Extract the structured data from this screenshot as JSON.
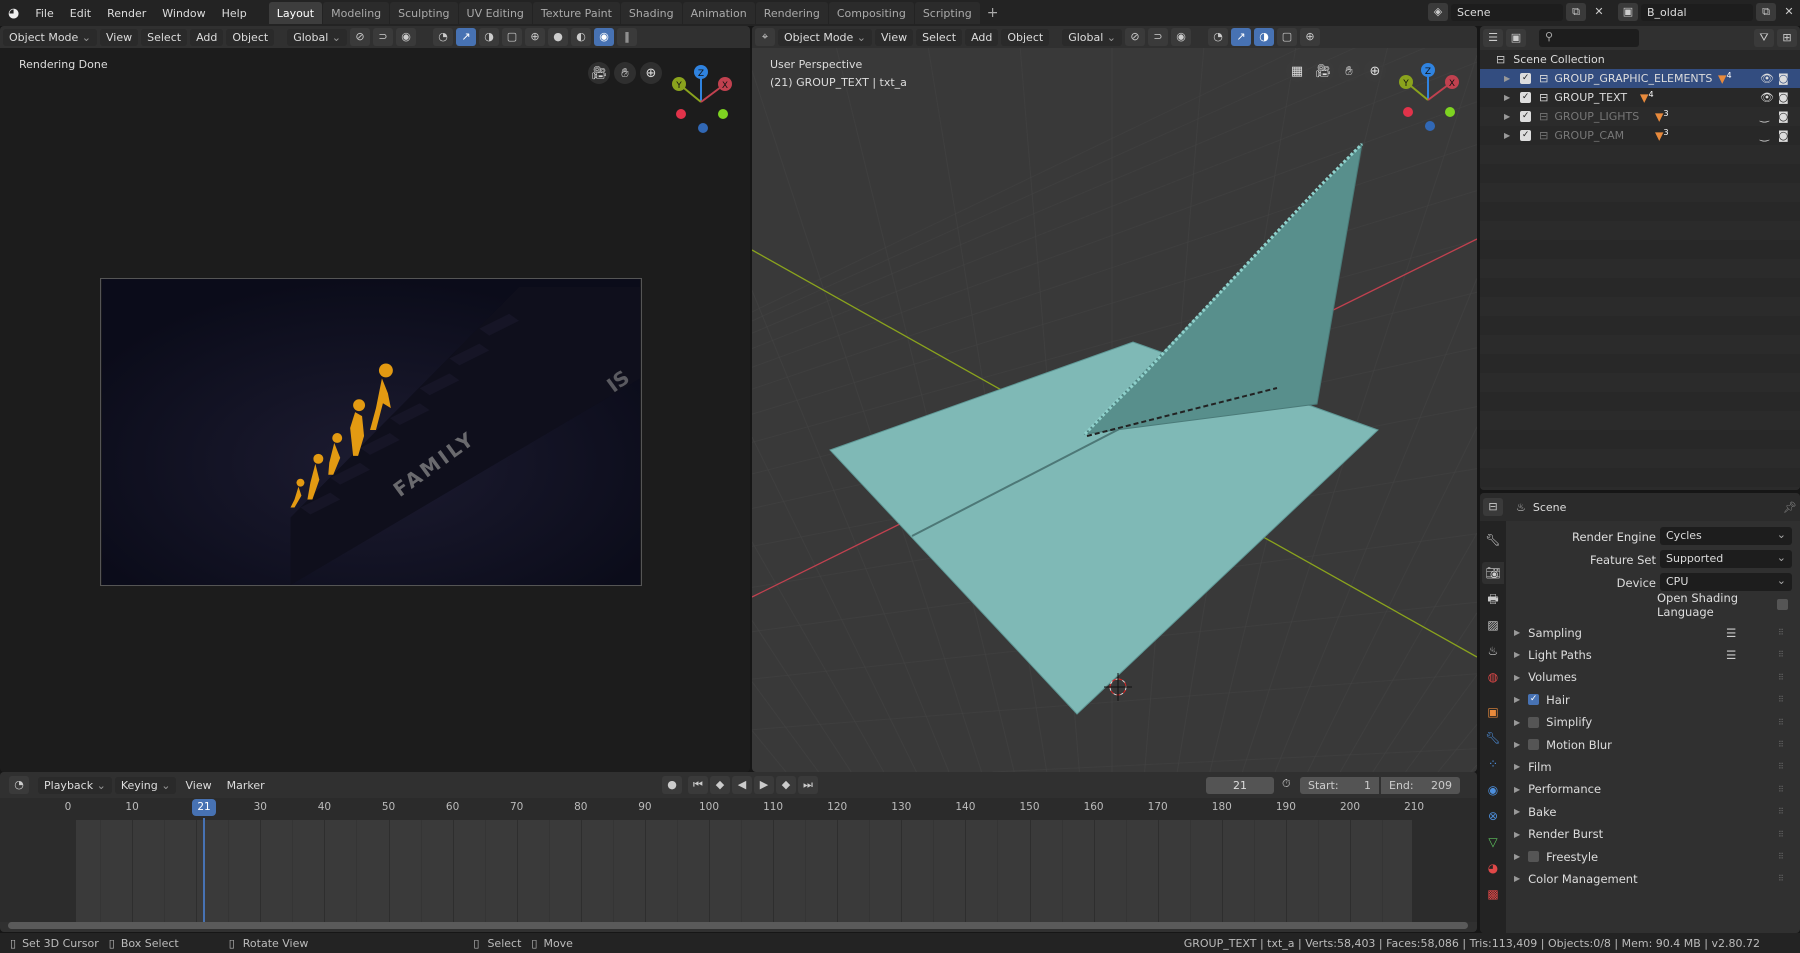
{
  "topbar": {
    "menus": [
      "File",
      "Edit",
      "Render",
      "Window",
      "Help"
    ],
    "tabs": [
      "Layout",
      "Modeling",
      "Sculpting",
      "UV Editing",
      "Texture Paint",
      "Shading",
      "Animation",
      "Rendering",
      "Compositing",
      "Scripting"
    ],
    "active_tab": "Layout",
    "scene": "Scene",
    "view_layer": "B_oldal"
  },
  "image_editor": {
    "mode": "Object Mode",
    "menus": [
      "View",
      "Select",
      "Add",
      "Object"
    ],
    "orientation": "Global",
    "status": "Rendering Done",
    "render_text": [
      "FAMILY",
      "IS"
    ]
  },
  "viewport": {
    "mode": "Object Mode",
    "menus": [
      "View",
      "Select",
      "Add",
      "Object"
    ],
    "orientation": "Global",
    "perspective": "User Perspective",
    "object_info": "(21) GROUP_TEXT | txt_a",
    "axes": {
      "x": "X",
      "y": "Y",
      "z": "Z"
    },
    "colors": {
      "plane": "#7fb9b6",
      "x_axis": "#c1414f",
      "y_axis": "#8aa31d"
    }
  },
  "outliner": {
    "root": "Scene Collection",
    "items": [
      {
        "name": "GROUP_GRAPHIC_ELEMENTS",
        "badge": "4",
        "selected": true,
        "visible": true
      },
      {
        "name": "GROUP_TEXT",
        "badge": "4",
        "selected": false,
        "visible": true
      },
      {
        "name": "GROUP_LIGHTS",
        "badge": "3",
        "selected": false,
        "visible": false
      },
      {
        "name": "GROUP_CAM",
        "badge": "3",
        "selected": false,
        "visible": false
      }
    ]
  },
  "properties": {
    "context": "Scene",
    "render_engine_label": "Render Engine",
    "render_engine": "Cycles",
    "feature_set_label": "Feature Set",
    "feature_set": "Supported",
    "device_label": "Device",
    "device": "CPU",
    "osl_label": "Open Shading Language",
    "osl": false,
    "panels": [
      {
        "label": "Sampling",
        "check": null
      },
      {
        "label": "Light Paths",
        "check": null
      },
      {
        "label": "Volumes",
        "check": null
      },
      {
        "label": "Hair",
        "check": true
      },
      {
        "label": "Simplify",
        "check": false
      },
      {
        "label": "Motion Blur",
        "check": false
      },
      {
        "label": "Film",
        "check": null
      },
      {
        "label": "Performance",
        "check": null
      },
      {
        "label": "Bake",
        "check": null
      },
      {
        "label": "Render Burst",
        "check": null
      },
      {
        "label": "Freestyle",
        "check": false
      },
      {
        "label": "Color Management",
        "check": null
      }
    ]
  },
  "timeline": {
    "menus": [
      "Playback",
      "Keying",
      "View",
      "Marker"
    ],
    "current_frame": "21",
    "start_label": "Start:",
    "start": "1",
    "end_label": "End:",
    "end": "209",
    "ticks": [
      "0",
      "10",
      "20",
      "30",
      "40",
      "50",
      "60",
      "70",
      "80",
      "90",
      "100",
      "110",
      "120",
      "130",
      "140",
      "150",
      "160",
      "170",
      "180",
      "190",
      "200",
      "210"
    ]
  },
  "statusbar": {
    "left": [
      "Set 3D Cursor",
      "Box Select",
      "Rotate View",
      "Select",
      "Move"
    ],
    "stats": "GROUP_TEXT | txt_a | Verts:58,403 | Faces:58,086 | Tris:113,409 | Objects:0/8 | Mem: 90.4 MB | v2.80.72"
  }
}
